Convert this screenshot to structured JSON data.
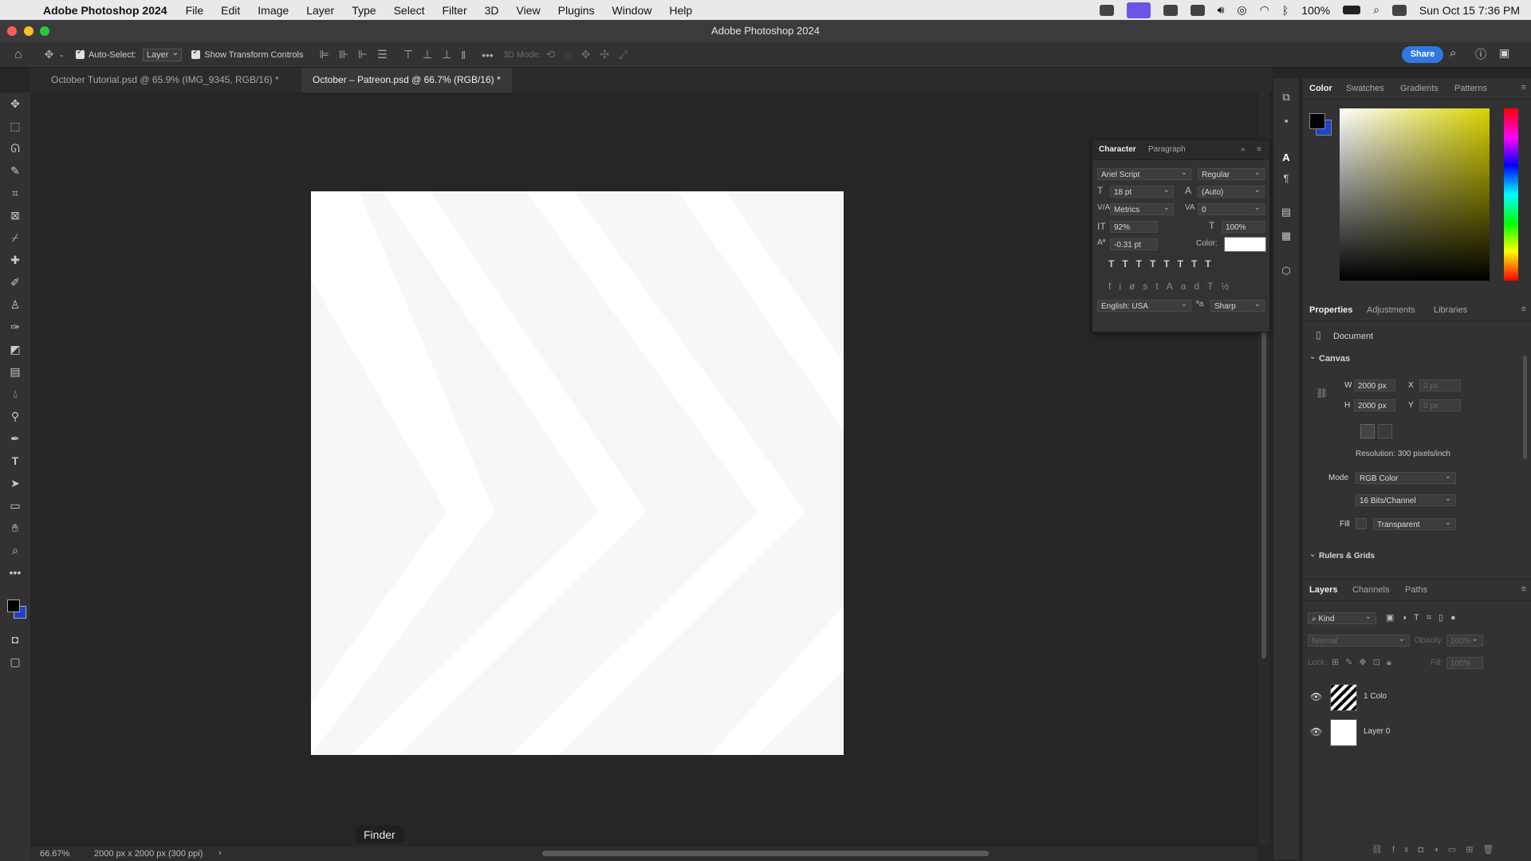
{
  "menubar": {
    "app_name": "Adobe Photoshop 2024",
    "items": [
      "File",
      "Edit",
      "Image",
      "Layer",
      "Type",
      "Select",
      "Filter",
      "3D",
      "View",
      "Plugins",
      "Window",
      "Help"
    ],
    "battery": "100%",
    "datetime": "Sun Oct 15  7:36 PM"
  },
  "titlebar": {
    "title": "Adobe Photoshop 2024"
  },
  "options": {
    "auto_select_label": "Auto-Select:",
    "auto_select_value": "Layer",
    "transform_label": "Show Transform Controls",
    "mode_3d": "3D Mode:",
    "share_label": "Share"
  },
  "tabs": [
    {
      "label": "October Tutorial.psd @ 65.9% (IMG_9345, RGB/16) *"
    },
    {
      "label": "October – Patreon.psd @ 66.7% (RGB/16) *"
    }
  ],
  "status": {
    "zoom": "66.67%",
    "doc_info": "2000 px x 2000 px (300 ppi)",
    "tooltip": "Finder"
  },
  "character": {
    "tab_character": "Character",
    "tab_paragraph": "Paragraph",
    "font_family": "Ariel Script",
    "font_style": "Regular",
    "size": "18 pt",
    "leading": "(Auto)",
    "kerning": "Metrics",
    "tracking": "0",
    "vscale": "92%",
    "hscale": "100%",
    "baseline": "-0.31 pt",
    "color_label": "Color:",
    "language": "English: USA",
    "aa_label": "ªa",
    "antialias": "Sharp"
  },
  "color_panel": {
    "tabs": [
      "Color",
      "Swatches",
      "Gradients",
      "Patterns"
    ]
  },
  "properties": {
    "tabs": [
      "Properties",
      "Adjustments",
      "Libraries"
    ],
    "doc_label": "Document",
    "canvas_label": "Canvas",
    "w_label": "W",
    "w_value": "2000 px",
    "h_label": "H",
    "h_value": "2000 px",
    "x_label": "X",
    "y_label": "Y",
    "x_value": "0 px",
    "y_value": "0 px",
    "resolution": "Resolution: 300 pixels/inch",
    "mode_label": "Mode",
    "mode_value": "RGB Color",
    "depth_value": "16 Bits/Channel",
    "fill_label": "Fill",
    "fill_value": "Transparent",
    "rulers_label": "Rulers & Grids"
  },
  "layers_panel": {
    "tabs": [
      "Layers",
      "Channels",
      "Paths"
    ],
    "filter_kind": "Kind",
    "blend": "Normal",
    "opacity_label": "Opacity:",
    "opacity_value": "100%",
    "lock_label": "Lock:",
    "fill_label": "Fill:",
    "fill_value": "100%",
    "layers": [
      {
        "name": "1 Colo"
      },
      {
        "name": "Layer 0"
      }
    ]
  },
  "colors": {
    "accent": "#2f78e4",
    "foreground": "#000000",
    "background": "#1c44c8"
  }
}
